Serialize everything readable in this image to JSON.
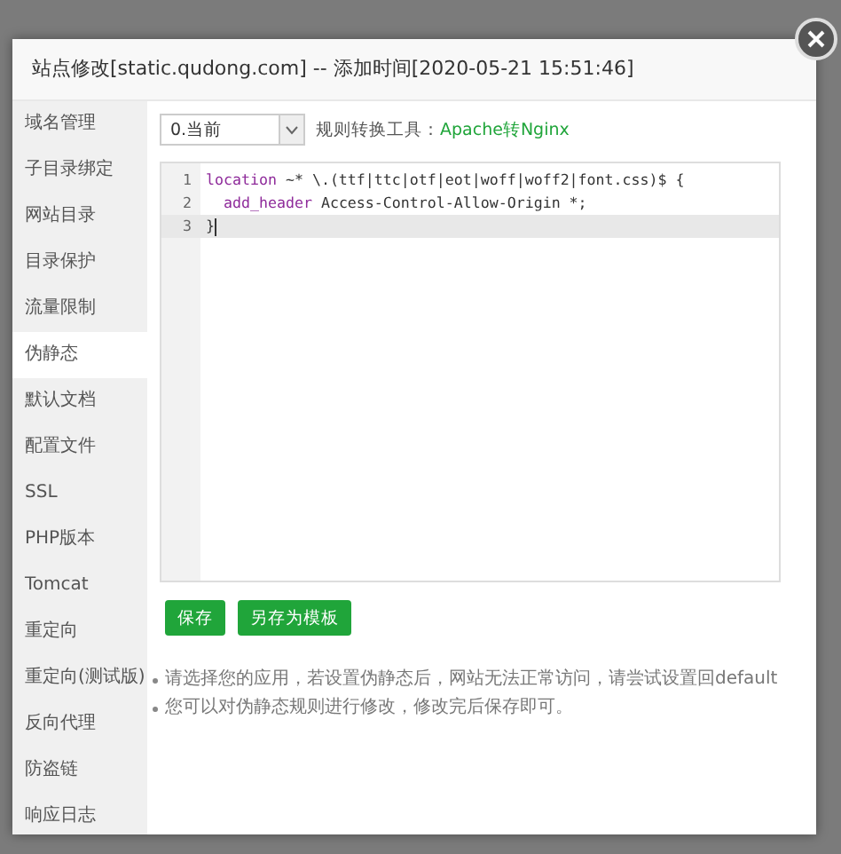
{
  "window": {
    "title": "站点修改[static.qudong.com] -- 添加时间[2020-05-21 15:51:46]"
  },
  "sidebar": {
    "items": [
      {
        "label": "域名管理",
        "selected": false
      },
      {
        "label": "子目录绑定",
        "selected": false
      },
      {
        "label": "网站目录",
        "selected": false
      },
      {
        "label": "目录保护",
        "selected": false
      },
      {
        "label": "流量限制",
        "selected": false
      },
      {
        "label": "伪静态",
        "selected": true
      },
      {
        "label": "默认文档",
        "selected": false
      },
      {
        "label": "配置文件",
        "selected": false
      },
      {
        "label": "SSL",
        "selected": false
      },
      {
        "label": "PHP版本",
        "selected": false
      },
      {
        "label": "Tomcat",
        "selected": false
      },
      {
        "label": "重定向",
        "selected": false
      },
      {
        "label": "重定向(测试版)",
        "selected": false
      },
      {
        "label": "反向代理",
        "selected": false
      },
      {
        "label": "防盗链",
        "selected": false
      },
      {
        "label": "响应日志",
        "selected": false
      }
    ]
  },
  "template_select": {
    "value": "0.当前"
  },
  "converter": {
    "label": "规则转换工具：",
    "link": "Apache转Nginx"
  },
  "editor": {
    "lines": [
      {
        "number": "1",
        "indent": false,
        "keyword": "location",
        "text": " ~* \\.(ttf|ttc|otf|eot|woff|woff2|font.css)$ {",
        "active": false
      },
      {
        "number": "2",
        "indent": true,
        "keyword": "add_header",
        "text": " Access-Control-Allow-Origin *;",
        "active": false
      },
      {
        "number": "3",
        "indent": false,
        "text": "}",
        "active": true
      }
    ]
  },
  "buttons": [
    "保存",
    "另存为模板"
  ],
  "notes": [
    "请选择您的应用，若设置伪静态后，网站无法正常访问，请尝试设置回default",
    "您可以对伪静态规则进行修改，修改完后保存即可。"
  ]
}
